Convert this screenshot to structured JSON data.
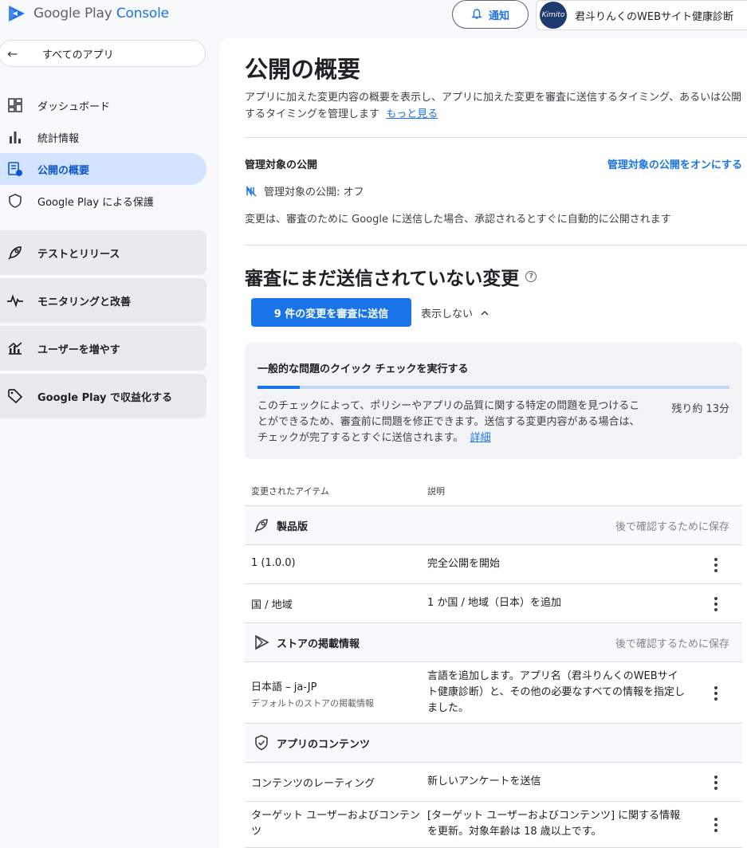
{
  "header": {
    "logo_text_main": "Google Play",
    "logo_text_console": "Console",
    "notify_label": "通知",
    "account_name": "君斗りんくのWEBサイト健康診断",
    "avatar_text": "Kimito"
  },
  "sidebar": {
    "back_label": "すべてのアプリ",
    "items": [
      {
        "label": "ダッシュボード"
      },
      {
        "label": "統計情報"
      },
      {
        "label": "公開の概要"
      },
      {
        "label": "Google Play による保護"
      }
    ],
    "groups": [
      {
        "label": "テストとリリース"
      },
      {
        "label": "モニタリングと改善"
      },
      {
        "label": "ユーザーを増やす"
      },
      {
        "label": "Google Play で収益化する"
      }
    ]
  },
  "main": {
    "title": "公開の概要",
    "description": "アプリに加えた変更内容の概要を表示し、アプリに加えた変更を審査に送信するタイミング、あるいは公開するタイミングを管理します",
    "learn_more": "もっと見る",
    "managed": {
      "title": "管理対象の公開",
      "enable_link": "管理対象の公開をオンにする",
      "status": "管理対象の公開: オフ",
      "note": "変更は、審査のために Google に送信した場合、承認されるとすぐに自動的に公開されます"
    },
    "pending": {
      "title": "審査にまだ送信されていない変更",
      "submit_button": "9 件の変更を審査に送信",
      "hide_label": "表示しない"
    },
    "quick_check": {
      "title": "一般的な問題のクイック チェックを実行する",
      "progress": 0.09,
      "description": "このチェックによって、ポリシーやアプリの品質に関する特定の問題を見つけることができるため、審査前に問題を修正できます。送信する変更内容がある場合は、チェックが完了するとすぐに送信されます。",
      "details_link": "詳細",
      "remaining": "残り約 13分"
    },
    "table": {
      "col_item": "変更されたアイテム",
      "col_desc": "説明",
      "sections": [
        {
          "name": "製品版",
          "save_label": "後で確認するために保存",
          "rows": [
            {
              "item": "1 (1.0.0)",
              "desc": "完全公開を開始"
            },
            {
              "item": "国 / 地域",
              "desc": "1 か国 / 地域（日本）を追加"
            }
          ]
        },
        {
          "name": "ストアの掲載情報",
          "save_label": "後で確認するために保存",
          "rows": [
            {
              "item": "日本語 – ja-JP",
              "sub": "デフォルトのストアの掲載情報",
              "desc": "言語を追加します。アプリ名（君斗りんくのWEBサイト健康診断）と、その他の必要なすべての情報を指定しました。"
            }
          ]
        },
        {
          "name": "アプリのコンテンツ",
          "save_label": "",
          "rows": [
            {
              "item": "コンテンツのレーティング",
              "desc": "新しいアンケートを送信"
            },
            {
              "item": "ターゲット ユーザーおよびコンテンツ",
              "desc": "[ターゲット ユーザーおよびコンテンツ] に関する情報を更新。対象年齢は 18 歳以上です。"
            }
          ]
        }
      ]
    }
  }
}
